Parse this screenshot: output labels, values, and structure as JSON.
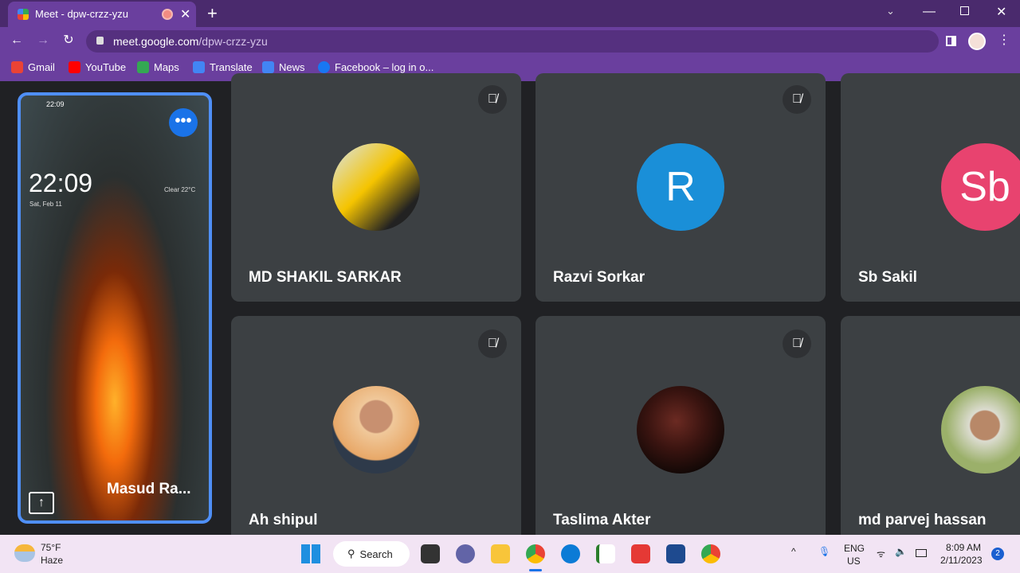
{
  "browser": {
    "tab_title": "Meet - dpw-crzz-yzu",
    "url_domain": "meet.google.com",
    "url_path": "/dpw-crzz-yzu",
    "bookmarks": [
      {
        "label": "Gmail",
        "color": "#ea4335"
      },
      {
        "label": "YouTube",
        "color": "#ff0000"
      },
      {
        "label": "Maps",
        "color": "#34a853"
      },
      {
        "label": "Translate",
        "color": "#4285f4"
      },
      {
        "label": "News",
        "color": "#4285f4"
      },
      {
        "label": "Facebook – log in o...",
        "color": "#1877f2"
      }
    ]
  },
  "self_tile": {
    "name": "Masud Ra...",
    "phone_time": "22:09",
    "phone_clock": "22:09",
    "phone_date": "Sat, Feb 11",
    "phone_weather": "Clear 22°C"
  },
  "participants": [
    {
      "name": "MD SHAKIL SARKAR",
      "avatar": "photo-car",
      "muted": true
    },
    {
      "name": "Razvi Sorkar",
      "initial": "R",
      "avatar_color": "#1a8fd8",
      "muted": true
    },
    {
      "name": "Sb Sakil",
      "initial": "Sb",
      "avatar_color": "#e8436f",
      "muted": false
    },
    {
      "name": "Ah shipul",
      "avatar": "photo-person",
      "muted": true
    },
    {
      "name": "Taslima Akter",
      "avatar": "photo-dark",
      "muted": true
    },
    {
      "name": "md parvej hassan",
      "avatar": "photo-person-cap",
      "muted": false
    }
  ],
  "taskbar": {
    "weather_temp": "75°F",
    "weather_desc": "Haze",
    "search_label": "Search",
    "lang1": "ENG",
    "lang2": "US",
    "time": "8:09 AM",
    "date": "2/11/2023",
    "notification_count": "2"
  }
}
